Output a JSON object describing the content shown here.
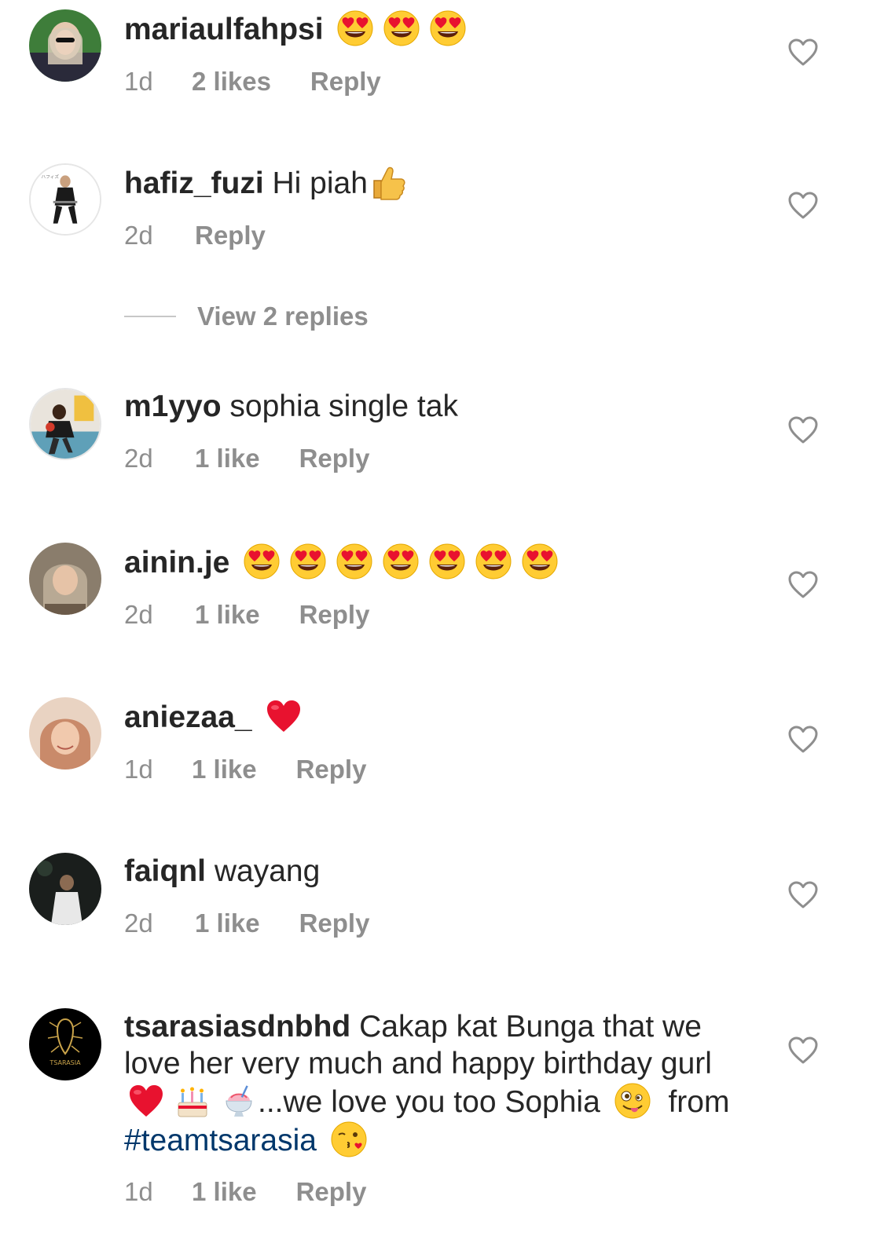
{
  "comments": [
    {
      "username": "mariaulfahpsi",
      "text": "",
      "emojis_after": [
        "heart-eyes",
        "heart-eyes",
        "heart-eyes"
      ],
      "age": "1d",
      "likes": "2 likes",
      "reply": "Reply"
    },
    {
      "username": "hafiz_fuzi",
      "text": "Hi piah",
      "emojis_after": [
        "thumbs-up"
      ],
      "age": "2d",
      "likes": "",
      "reply": "Reply"
    },
    {
      "username": "m1yyo",
      "text": "sophia single tak",
      "emojis_after": [],
      "age": "2d",
      "likes": "1 like",
      "reply": "Reply"
    },
    {
      "username": "ainin.je",
      "text": "",
      "emojis_after": [
        "heart-eyes",
        "heart-eyes",
        "heart-eyes",
        "heart-eyes",
        "heart-eyes",
        "heart-eyes",
        "heart-eyes"
      ],
      "age": "2d",
      "likes": "1 like",
      "reply": "Reply"
    },
    {
      "username": "aniezaa_",
      "text": "",
      "emojis_after": [
        "red-heart"
      ],
      "age": "1d",
      "likes": "1 like",
      "reply": "Reply"
    },
    {
      "username": "faiqnl",
      "text": "wayang",
      "emojis_after": [],
      "age": "2d",
      "likes": "1 like",
      "reply": "Reply"
    },
    {
      "username": "tsarasiasdnbhd",
      "text_parts": [
        "Cakap kat Bunga that we love her very much and happy birthday gurl",
        "...we love you too Sophia",
        "from",
        "#teamtsarasia"
      ],
      "age": "1d",
      "likes": "1 like",
      "reply": "Reply"
    }
  ],
  "view_replies": "View 2 replies",
  "colors": {
    "text": "#262626",
    "muted": "#8e8e8e",
    "hashtag": "#00376b"
  }
}
